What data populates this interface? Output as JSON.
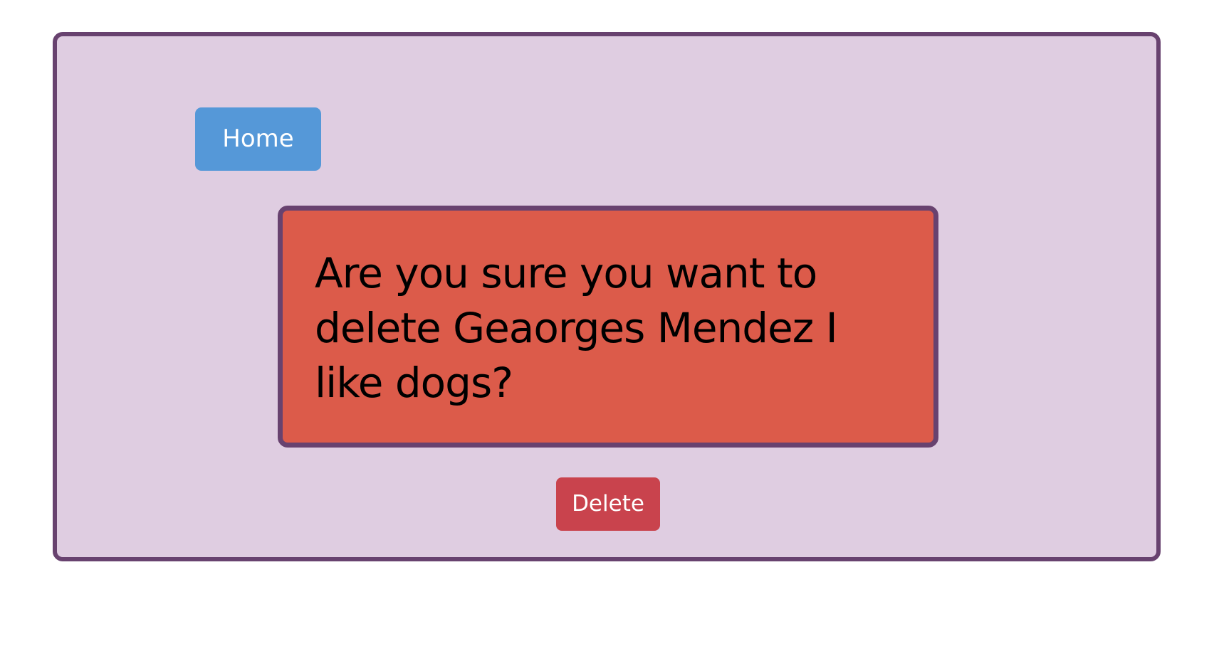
{
  "nav": {
    "home_label": "Home"
  },
  "confirm": {
    "message": "Are you sure you want to delete Geaorges Mendez I like dogs?",
    "delete_label": "Delete"
  },
  "colors": {
    "page_background": "#ffffff",
    "panel_background": "#dfcde1",
    "panel_border": "#68426f",
    "home_button": "#5598d8",
    "confirm_box": "#dc5b4a",
    "delete_button": "#c9434d"
  }
}
